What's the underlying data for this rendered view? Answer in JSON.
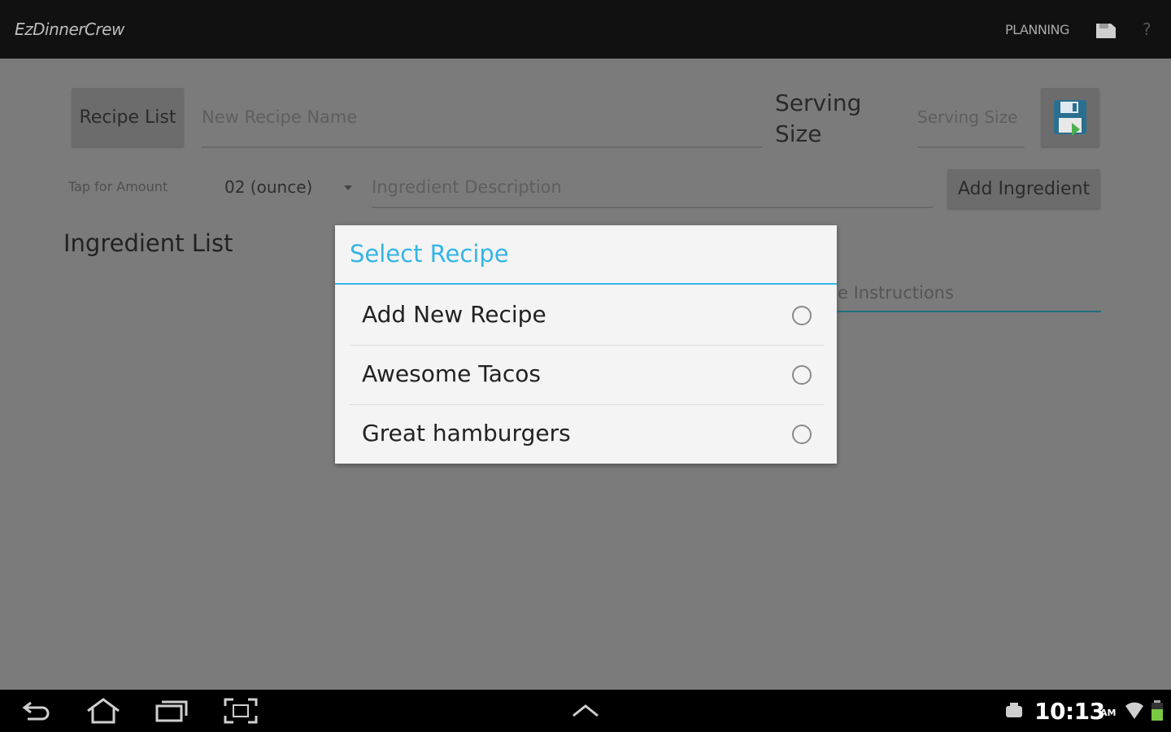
{
  "app": {
    "title": "EzDinnerCrew",
    "mode_label": "PLANNING",
    "help_label": "?"
  },
  "header_row": {
    "recipe_list_button": "Recipe List",
    "recipe_name_placeholder": "New Recipe Name",
    "serving_label_line1": "Serving",
    "serving_label_line2": "Size",
    "serving_size_placeholder": "Serving Size"
  },
  "ingredient_row": {
    "tap_label": "Tap for Amount",
    "unit_value": "02 (ounce)",
    "description_placeholder": "Ingredient Description",
    "add_button": "Add Ingredient"
  },
  "ingredient_list_title": "Ingredient List",
  "instructions_placeholder_visible": "e Instructions",
  "dialog": {
    "title": "Select Recipe",
    "options": [
      {
        "label": "Add New Recipe",
        "selected": false
      },
      {
        "label": "Awesome Tacos",
        "selected": false
      },
      {
        "label": "Great hamburgers",
        "selected": false
      }
    ]
  },
  "system_bar": {
    "time": "10:13",
    "ampm": "AM",
    "icons": [
      "back-icon",
      "home-icon",
      "recent-apps-icon",
      "screenshot-icon",
      "up-chevron-icon",
      "notification-icon",
      "wifi-icon",
      "battery-icon"
    ]
  },
  "colors": {
    "accent": "#33b5e5",
    "action_bar": "#111111",
    "dim_background": "#7b7b7b",
    "dialog_background": "#f4f4f4"
  }
}
